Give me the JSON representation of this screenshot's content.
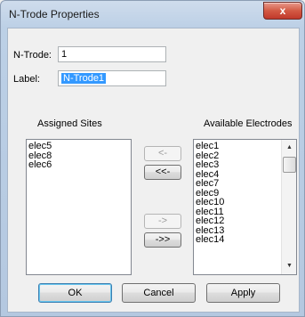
{
  "window": {
    "title": "N-Trode Properties",
    "close_glyph": "x"
  },
  "ntrode": {
    "label": "N-Trode:",
    "value": "1"
  },
  "label_field": {
    "label": "Label:",
    "value": "N-Trode1"
  },
  "assigned": {
    "heading": "Assigned Sites",
    "items": [
      "elec5",
      "elec8",
      "elec6"
    ]
  },
  "available": {
    "heading": "Available Electrodes",
    "items": [
      "elec1",
      "elec2",
      "elec3",
      "elec4",
      "elec7",
      "elec9",
      "elec10",
      "elec11",
      "elec12",
      "elec13",
      "elec14"
    ]
  },
  "move_buttons": {
    "move_left": "<-",
    "move_all_left": "<<-",
    "move_right": "->",
    "move_all_right": "->>"
  },
  "footer": {
    "ok": "OK",
    "cancel": "Cancel",
    "apply": "Apply"
  }
}
